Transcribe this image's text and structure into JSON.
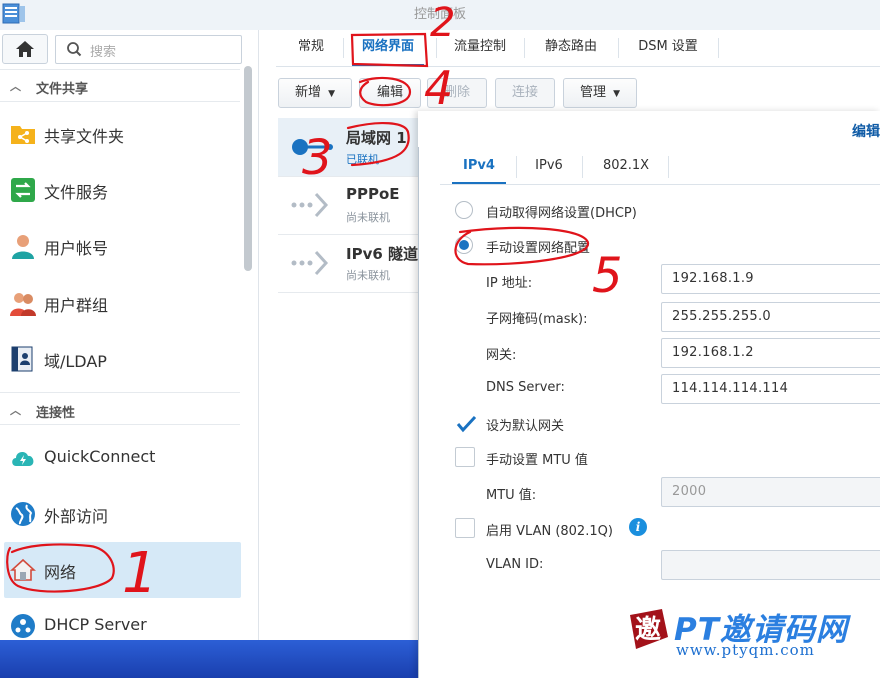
{
  "window": {
    "title": "控制面板"
  },
  "sidebar": {
    "search_placeholder": "搜索",
    "sections": [
      {
        "label": "文件共享"
      },
      {
        "label": "连接性"
      }
    ],
    "items": [
      {
        "label": "共享文件夹"
      },
      {
        "label": "文件服务"
      },
      {
        "label": "用户帐号"
      },
      {
        "label": "用户群组"
      },
      {
        "label": "域/LDAP"
      },
      {
        "label": "QuickConnect"
      },
      {
        "label": "外部访问"
      },
      {
        "label": "网络"
      },
      {
        "label": "DHCP Server"
      }
    ]
  },
  "tabs": [
    {
      "label": "常规"
    },
    {
      "label": "网络界面"
    },
    {
      "label": "流量控制"
    },
    {
      "label": "静态路由"
    },
    {
      "label": "DSM 设置"
    }
  ],
  "toolbar": {
    "add": "新增",
    "edit": "编辑",
    "delete": "删除",
    "connect": "连接",
    "manage": "管理"
  },
  "interfaces": [
    {
      "name": "局域网 1",
      "status": "已联机"
    },
    {
      "name": "PPPoE",
      "status": "尚未联机"
    },
    {
      "name": "IPv6 隧道",
      "status": "尚未联机"
    }
  ],
  "dialog": {
    "title": "编辑",
    "tabs": [
      "IPv4",
      "IPv6",
      "802.1X"
    ],
    "dhcp_label": "自动取得网络设置(DHCP)",
    "manual_label": "手动设置网络配置",
    "fields": [
      {
        "label": "IP 地址:",
        "value": "192.168.1.9"
      },
      {
        "label": "子网掩码(mask):",
        "value": "255.255.255.0"
      },
      {
        "label": "网关:",
        "value": "192.168.1.2"
      },
      {
        "label": "DNS Server:",
        "value": "114.114.114.114"
      }
    ],
    "default_gateway_label": "设为默认网关",
    "mtu_manual_label": "手动设置 MTU 值",
    "mtu_label": "MTU 值:",
    "mtu_value": "2000",
    "vlan_label": "启用 VLAN (802.1Q)",
    "vlan_id_label": "VLAN ID:",
    "vlan_id_value": ""
  },
  "annotations": [
    "1",
    "2",
    "3",
    "4",
    "5"
  ],
  "watermark": {
    "brand": "PT邀请码网",
    "url": "www.ptyqm.com",
    "logo_char": "邀"
  },
  "colors": {
    "accent": "#1a72c1",
    "annotation": "#e0141b",
    "watermark": "#2b7fe0"
  }
}
